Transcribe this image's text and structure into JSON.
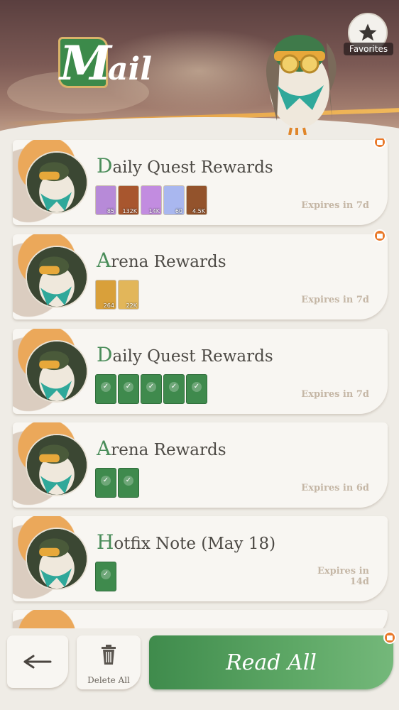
{
  "header": {
    "title_initial": "M",
    "title_rest": "ail",
    "favorites_label": "Favorites"
  },
  "mail_items": [
    {
      "title": "Daily Quest Rewards",
      "expires": "Expires in 7d",
      "has_gift_badge": true,
      "rewards": [
        {
          "icon": "potion-icon",
          "qty": "85",
          "claimed": false
        },
        {
          "icon": "book-icon",
          "qty": "132K",
          "claimed": false
        },
        {
          "icon": "potion-icon",
          "qty": "14K",
          "claimed": false
        },
        {
          "icon": "star-crystal-icon",
          "qty": "60",
          "claimed": false
        },
        {
          "icon": "book-icon",
          "qty": "4.5K",
          "claimed": false
        }
      ]
    },
    {
      "title": "Arena Rewards",
      "expires": "Expires in 7d",
      "has_gift_badge": true,
      "rewards": [
        {
          "icon": "medal-icon",
          "qty": "264",
          "claimed": false
        },
        {
          "icon": "gold-coins-icon",
          "qty": "22K",
          "claimed": false
        }
      ]
    },
    {
      "title": "Daily Quest Rewards",
      "expires": "Expires in 7d",
      "has_gift_badge": false,
      "rewards": [
        {
          "icon": "check-icon",
          "qty": "",
          "claimed": true
        },
        {
          "icon": "check-icon",
          "qty": "",
          "claimed": true
        },
        {
          "icon": "check-icon",
          "qty": "",
          "claimed": true
        },
        {
          "icon": "check-icon",
          "qty": "",
          "claimed": true
        },
        {
          "icon": "check-icon",
          "qty": "",
          "claimed": true
        }
      ]
    },
    {
      "title": "Arena Rewards",
      "expires": "Expires in 6d",
      "has_gift_badge": false,
      "rewards": [
        {
          "icon": "check-icon",
          "qty": "",
          "claimed": true
        },
        {
          "icon": "check-icon",
          "qty": "",
          "claimed": true
        }
      ]
    },
    {
      "title": "Hotfix Note (May 18)",
      "expires": "Expires in 14d",
      "has_gift_badge": false,
      "rewards": [
        {
          "icon": "check-icon",
          "qty": "",
          "claimed": true
        }
      ]
    }
  ],
  "footer": {
    "delete_all_label": "Delete All",
    "read_all_label": "Read All"
  },
  "colors": {
    "accent_green": "#3f8b4c",
    "gift_orange": "#e9792a",
    "title_text": "#4d4a45"
  }
}
